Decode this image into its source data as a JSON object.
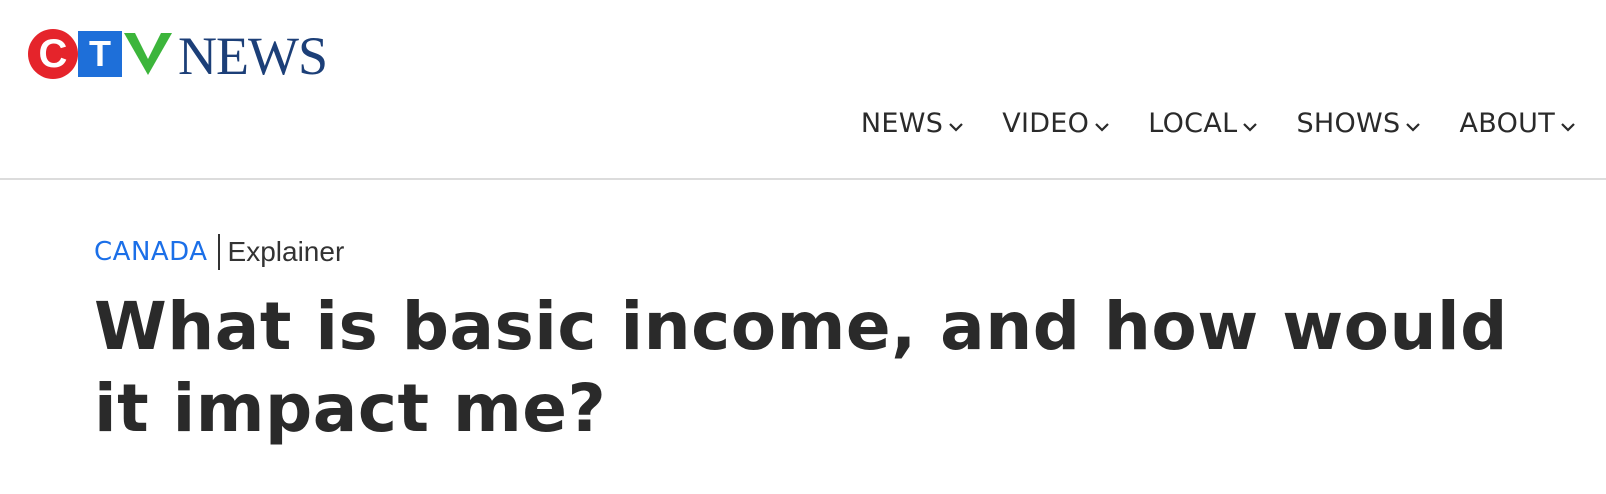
{
  "header": {
    "logo": {
      "letters": [
        "C",
        "T",
        "V"
      ],
      "wordmark": "NEWS",
      "colors": {
        "c": "#e5242b",
        "t": "#1e6fd9",
        "v": "#3cb53b",
        "wordmark": "#1c3f78"
      }
    },
    "nav": [
      {
        "label": "NEWS"
      },
      {
        "label": "VIDEO"
      },
      {
        "label": "LOCAL"
      },
      {
        "label": "SHOWS"
      },
      {
        "label": "ABOUT"
      }
    ]
  },
  "article": {
    "section": "CANADA",
    "type": "Explainer",
    "headline": "What is basic income, and how would it impact me?"
  },
  "colors": {
    "section_link": "#1b6fe8",
    "text": "#2a2a2a",
    "divider": "#dcdcdc"
  }
}
